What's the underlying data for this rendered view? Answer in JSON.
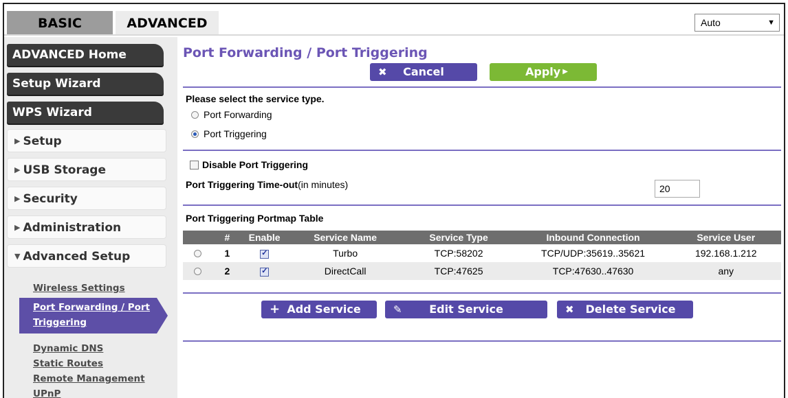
{
  "tabs": {
    "basic": "BASIC",
    "advanced": "ADVANCED"
  },
  "language_select": {
    "value": "Auto"
  },
  "sidebar": {
    "advanced_home": "ADVANCED Home",
    "setup_wizard": "Setup Wizard",
    "wps_wizard": "WPS Wizard",
    "setup": "Setup",
    "usb_storage": "USB Storage",
    "security": "Security",
    "administration": "Administration",
    "advanced_setup": "Advanced Setup",
    "sub": {
      "wireless_settings": "Wireless Settings",
      "port_forwarding_line1": "Port Forwarding / Port",
      "port_forwarding_line2": "Triggering",
      "dynamic_dns": "Dynamic DNS",
      "static_routes": "Static Routes",
      "remote_management": "Remote Management",
      "upnp": "UPnP"
    }
  },
  "main": {
    "title": "Port Forwarding / Port Triggering",
    "cancel_label": "Cancel",
    "apply_label": "Apply",
    "select_prompt": "Please select the service type.",
    "option_forwarding": "Port Forwarding",
    "option_triggering": "Port Triggering",
    "selected_option": "Port Triggering",
    "disable_label": "Disable Port Triggering",
    "disable_checked": false,
    "timeout_label_bold": "Port Triggering Time-out",
    "timeout_label_unit": "(in minutes)",
    "timeout_value": "20",
    "table_title": "Port Triggering Portmap Table",
    "table": {
      "headers": [
        "#",
        "Enable",
        "Service Name",
        "Service Type",
        "Inbound Connection",
        "Service User"
      ],
      "rows": [
        {
          "num": "1",
          "enabled": true,
          "service_name": "Turbo",
          "service_type": "TCP:58202",
          "inbound": "TCP/UDP:35619..35621",
          "user": "192.168.1.212"
        },
        {
          "num": "2",
          "enabled": true,
          "service_name": "DirectCall",
          "service_type": "TCP:47625",
          "inbound": "TCP:47630..47630",
          "user": "any"
        }
      ]
    },
    "add_label": "Add Service",
    "edit_label": "Edit Service",
    "delete_label": "Delete Service"
  },
  "colors": {
    "accent": "#5549a8",
    "title": "#6b55b5",
    "apply": "#7cb935",
    "rule": "#7a6ec2"
  }
}
